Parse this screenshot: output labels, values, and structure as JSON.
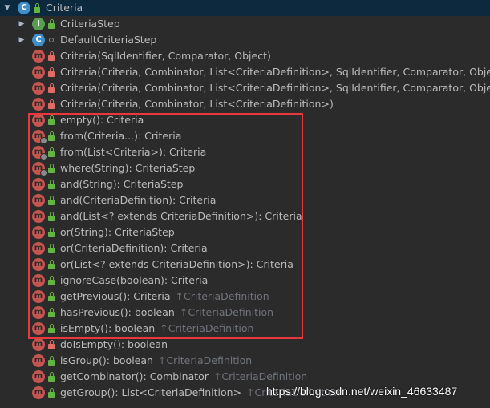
{
  "root": {
    "label": "Criteria"
  },
  "rows": [
    {
      "kind": "class",
      "arrow": "▶",
      "icon": "interface-icon",
      "vis": "lock-green",
      "label": "CriteriaStep",
      "inherited": ""
    },
    {
      "kind": "class",
      "arrow": "▶",
      "icon": "class-icon",
      "vis": "dot-grey",
      "label": "DefaultCriteriaStep",
      "inherited": ""
    },
    {
      "kind": "method",
      "vis": "lock-red",
      "label": "Criteria(SqlIdentifier, Comparator, Object)",
      "inherited": ""
    },
    {
      "kind": "method",
      "vis": "lock-red",
      "label": "Criteria(Criteria, Combinator, List<CriteriaDefinition>, SqlIdentifier, Comparator, Object)",
      "inherited": ""
    },
    {
      "kind": "method",
      "vis": "lock-red",
      "label": "Criteria(Criteria, Combinator, List<CriteriaDefinition>, SqlIdentifier, Comparator, Object, boo",
      "inherited": ""
    },
    {
      "kind": "method",
      "vis": "lock-red",
      "label": "Criteria(Criteria, Combinator, List<CriteriaDefinition>)",
      "inherited": ""
    },
    {
      "kind": "method",
      "vis": "lock-green",
      "label": "empty(): Criteria",
      "inherited": ""
    },
    {
      "kind": "method-static",
      "vis": "lock-green",
      "label": "from(Criteria...): Criteria",
      "inherited": ""
    },
    {
      "kind": "method-static",
      "vis": "lock-green",
      "label": "from(List<Criteria>): Criteria",
      "inherited": ""
    },
    {
      "kind": "method-static",
      "vis": "lock-green",
      "label": "where(String): CriteriaStep",
      "inherited": ""
    },
    {
      "kind": "method",
      "vis": "lock-green",
      "label": "and(String): CriteriaStep",
      "inherited": ""
    },
    {
      "kind": "method",
      "vis": "lock-green",
      "label": "and(CriteriaDefinition): Criteria",
      "inherited": ""
    },
    {
      "kind": "method",
      "vis": "lock-green",
      "label": "and(List<? extends CriteriaDefinition>): Criteria",
      "inherited": ""
    },
    {
      "kind": "method",
      "vis": "lock-green",
      "label": "or(String): CriteriaStep",
      "inherited": ""
    },
    {
      "kind": "method",
      "vis": "lock-green",
      "label": "or(CriteriaDefinition): Criteria",
      "inherited": ""
    },
    {
      "kind": "method",
      "vis": "lock-green",
      "label": "or(List<? extends CriteriaDefinition>): Criteria",
      "inherited": ""
    },
    {
      "kind": "method",
      "vis": "lock-green",
      "label": "ignoreCase(boolean): Criteria",
      "inherited": ""
    },
    {
      "kind": "method",
      "vis": "lock-green",
      "label": "getPrevious(): Criteria",
      "inherited": "↑CriteriaDefinition"
    },
    {
      "kind": "method",
      "vis": "lock-green",
      "label": "hasPrevious(): boolean",
      "inherited": "↑CriteriaDefinition"
    },
    {
      "kind": "method",
      "vis": "lock-green",
      "label": "isEmpty(): boolean",
      "inherited": "↑CriteriaDefinition"
    },
    {
      "kind": "method",
      "vis": "lock-red",
      "label": "doIsEmpty(): boolean",
      "inherited": ""
    },
    {
      "kind": "method",
      "vis": "lock-green",
      "label": "isGroup(): boolean",
      "inherited": "↑CriteriaDefinition"
    },
    {
      "kind": "method",
      "vis": "lock-green",
      "label": "getCombinator(): Combinator",
      "inherited": "↑CriteriaDefinition"
    },
    {
      "kind": "method",
      "vis": "lock-green",
      "label": "getGroup(): List<CriteriaDefinition>",
      "inherited": "↑CriteriaDefinition"
    }
  ],
  "watermark": "https://blog.csdn.net/weixin_46633487",
  "colors": {
    "highlight": "#e8383d",
    "background": "#2b2b2b",
    "selected": "#0d293e"
  }
}
